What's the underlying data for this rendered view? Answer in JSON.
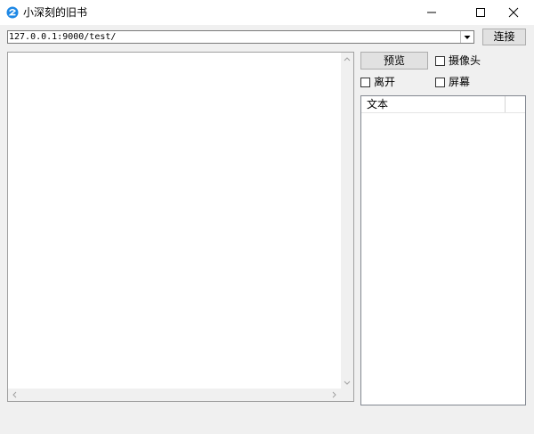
{
  "window": {
    "title": "小深刻的旧书",
    "icon": "app-icon",
    "controls": [
      "minimize-icon",
      "maximize-icon",
      "close-icon"
    ]
  },
  "toolbar": {
    "url_value": "127.0.0.1:9000/test/",
    "connect_label": "连接"
  },
  "controls": {
    "preview_label": "预览",
    "camera_label": "摄像头",
    "camera_checked": false,
    "leave_label": "离开",
    "leave_checked": false,
    "screen_label": "屏幕",
    "screen_checked": false
  },
  "list": {
    "columns": [
      "文本",
      ""
    ],
    "rows": []
  },
  "colors": {
    "titlebar": "#ffffff",
    "window_bg": "#f0f0f0",
    "button_bg": "#e1e1e1",
    "icon_blue": "#1e88e5"
  }
}
